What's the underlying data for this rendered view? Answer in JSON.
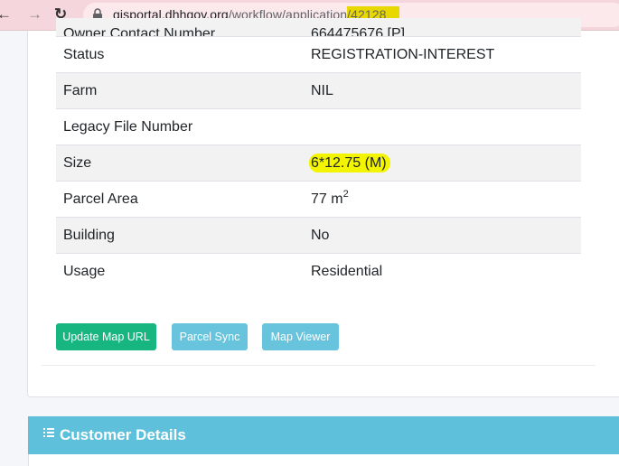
{
  "browser": {
    "url_domain": "gisportal.dhhgov.org",
    "url_path": "/workflow/application",
    "url_id": "/42128"
  },
  "details": {
    "partial_row": {
      "label": "Owner Contact Number",
      "value": "664475676 [P]"
    },
    "rows": [
      {
        "label": "Status",
        "value": "REGISTRATION-INTEREST"
      },
      {
        "label": "Farm",
        "value": "NIL"
      },
      {
        "label": "Legacy File Number",
        "value": ""
      },
      {
        "label": "Size",
        "value": "6*12.75 (M)"
      },
      {
        "label": "Parcel Area",
        "value": "77 m",
        "value_sup": "2"
      },
      {
        "label": "Building",
        "value": "No"
      },
      {
        "label": "Usage",
        "value": "Residential"
      }
    ]
  },
  "actions": {
    "update_map_url": "Update Map URL",
    "parcel_sync": "Parcel Sync",
    "map_viewer": "Map Viewer"
  },
  "customer": {
    "title": "Customer Details",
    "icon": "list-icon"
  },
  "colors": {
    "success": "#17b57f",
    "info": "#67c4dc",
    "header": "#5fc0dc",
    "highlight": "#f3f500"
  }
}
